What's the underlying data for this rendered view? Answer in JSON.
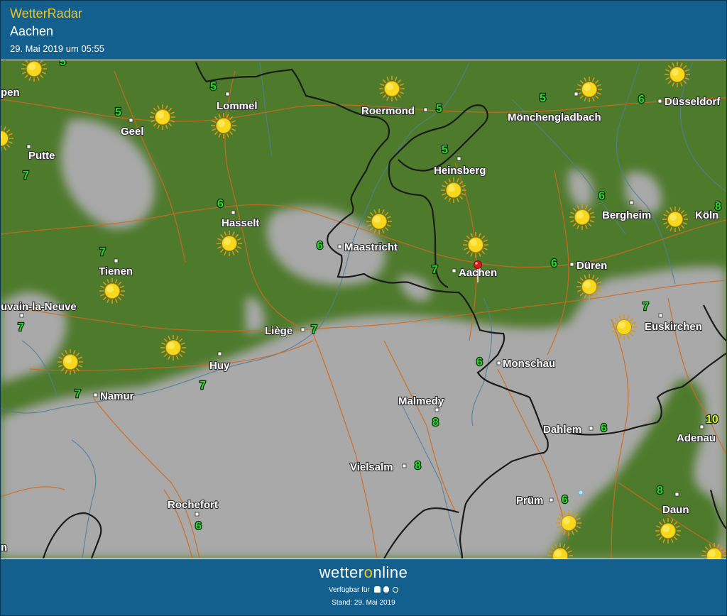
{
  "header": {
    "app_title": "WetterRadar",
    "location": "Aachen",
    "datetime": "29. Mai 2019 um 05:55"
  },
  "footer": {
    "brand_pre": "wetter",
    "brand_o": "o",
    "brand_post": "nline",
    "available": "Verfügbar für",
    "stand": "Stand: 29. Mai 2019"
  },
  "colors": {
    "header_bg": "#135f8e",
    "accent": "#f0c419",
    "land": "#4e7a2c",
    "cloud": "#a9a9a9",
    "temp": "#2bd62b",
    "temp_hot": "#e6ee14"
  },
  "map": {
    "cities": [
      {
        "name": "Lommel",
        "id": "lommel"
      },
      {
        "name": "Geel",
        "id": "geel"
      },
      {
        "name": "Putte",
        "id": "putte"
      },
      {
        "name": "Roermond",
        "id": "roermond"
      },
      {
        "name": "Mönchengladbach",
        "id": "moenchengladbach"
      },
      {
        "name": "Düsseldorf",
        "id": "duesseldorf"
      },
      {
        "name": "Heinsberg",
        "id": "heinsberg"
      },
      {
        "name": "Hasselt",
        "id": "hasselt"
      },
      {
        "name": "Bergheim",
        "id": "bergheim"
      },
      {
        "name": "Köln",
        "id": "koeln"
      },
      {
        "name": "Maastricht",
        "id": "maastricht"
      },
      {
        "name": "Tienen",
        "id": "tienen"
      },
      {
        "name": "Aachen",
        "id": "aachen"
      },
      {
        "name": "Düren",
        "id": "dueren"
      },
      {
        "name": "uvain-la-Neuve",
        "id": "louvain"
      },
      {
        "name": "Liège",
        "id": "liege"
      },
      {
        "name": "Euskirchen",
        "id": "euskirchen"
      },
      {
        "name": "Huy",
        "id": "huy"
      },
      {
        "name": "Monschau",
        "id": "monschau"
      },
      {
        "name": "Namur",
        "id": "namur"
      },
      {
        "name": "Malmedy",
        "id": "malmedy"
      },
      {
        "name": "Dahlem",
        "id": "dahlem"
      },
      {
        "name": "Adenau",
        "id": "adenau"
      },
      {
        "name": "Vielsalm",
        "id": "vielsalm"
      },
      {
        "name": "Prüm",
        "id": "pruem"
      },
      {
        "name": "Rochefort",
        "id": "rochefort"
      },
      {
        "name": "Daun",
        "id": "daun"
      },
      {
        "name": "pen",
        "id": "edge-pen"
      },
      {
        "name": "n",
        "id": "edge-n"
      }
    ],
    "temperatures": [
      "5",
      "5",
      "5",
      "6",
      "7",
      "5",
      "5",
      "6",
      "6",
      "8",
      "7",
      "6",
      "7",
      "6",
      "7",
      "7",
      "7",
      "7",
      "6",
      "8",
      "6",
      "10",
      "8",
      "6",
      "8",
      "6"
    ],
    "weather_icon": "sun-icon",
    "marker_icon": "location-pin-icon"
  }
}
